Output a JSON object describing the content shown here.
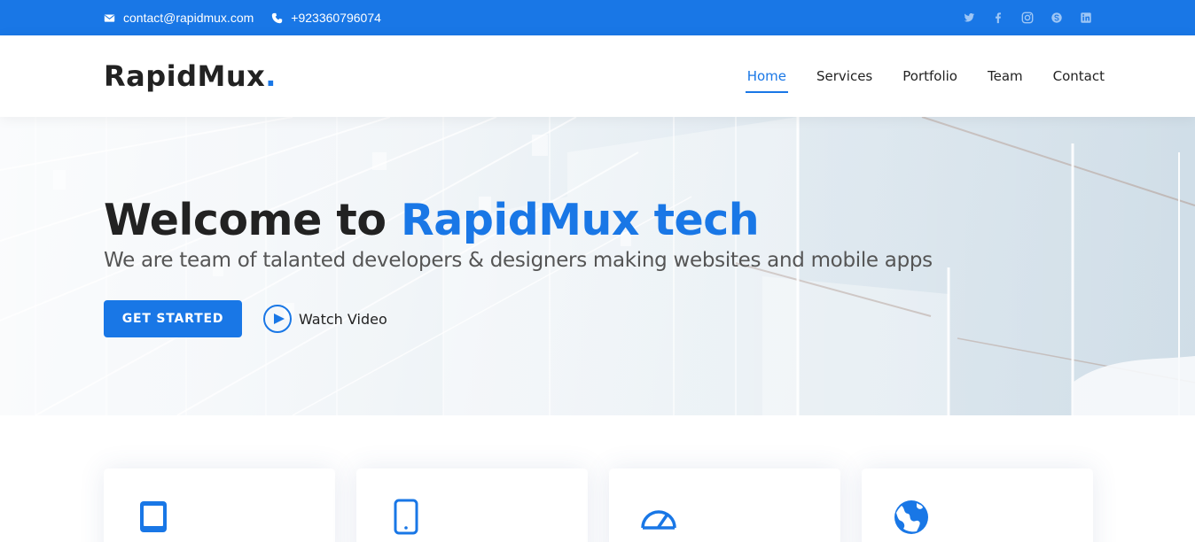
{
  "topbar": {
    "email": "contact@rapidmux.com",
    "phone": "+923360796074",
    "icons": [
      "envelope-icon",
      "phone-icon"
    ],
    "social": [
      "twitter-icon",
      "facebook-icon",
      "instagram-icon",
      "skype-icon",
      "linkedin-icon"
    ]
  },
  "header": {
    "logo_text": "RapidMux",
    "logo_dot": ".",
    "nav": [
      {
        "label": "Home",
        "active": true
      },
      {
        "label": "Services",
        "active": false
      },
      {
        "label": "Portfolio",
        "active": false
      },
      {
        "label": "Team",
        "active": false
      },
      {
        "label": "Contact",
        "active": false
      }
    ]
  },
  "hero": {
    "title_prefix": "Welcome to ",
    "title_accent": "RapidMux tech",
    "subtitle": "We are team of talanted developers & designers making websites and mobile apps",
    "cta_label": "GET STARTED",
    "video_label": "Watch Video"
  },
  "services": {
    "icons": [
      "tablet-icon",
      "mobile-phone-icon",
      "speedometer-icon",
      "globe-icon"
    ]
  },
  "colors": {
    "accent": "#1977e6",
    "text": "#222222",
    "muted": "#555555"
  }
}
